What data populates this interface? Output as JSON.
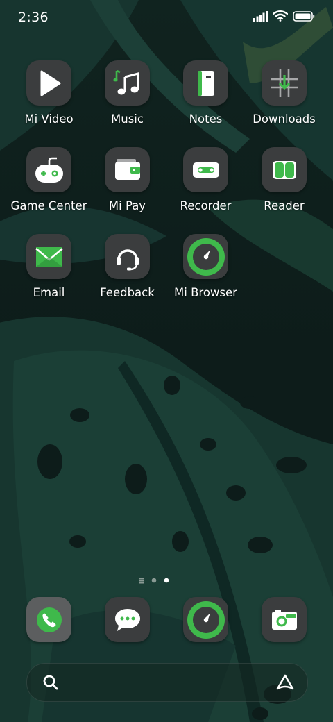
{
  "status_bar": {
    "time": "2:36",
    "icons": [
      "signal-icon",
      "wifi-icon",
      "battery-icon"
    ]
  },
  "apps": [
    {
      "label": "Mi Video",
      "icon": "play-icon"
    },
    {
      "label": "Music",
      "icon": "music-note-icon"
    },
    {
      "label": "Notes",
      "icon": "notebook-icon"
    },
    {
      "label": "Downloads",
      "icon": "download-icon"
    },
    {
      "label": "Game Center",
      "icon": "gamepad-icon"
    },
    {
      "label": "Mi Pay",
      "icon": "wallet-icon"
    },
    {
      "label": "Recorder",
      "icon": "recorder-icon"
    },
    {
      "label": "Reader",
      "icon": "book-icon"
    },
    {
      "label": "Email",
      "icon": "envelope-icon"
    },
    {
      "label": "Feedback",
      "icon": "headset-icon"
    },
    {
      "label": "Mi Browser",
      "icon": "compass-icon"
    }
  ],
  "page_indicator": {
    "pages": 3,
    "current": 3
  },
  "dock": [
    {
      "name": "phone",
      "icon": "phone-icon"
    },
    {
      "name": "messages",
      "icon": "chat-bubble-icon"
    },
    {
      "name": "browser",
      "icon": "compass-icon"
    },
    {
      "name": "camera",
      "icon": "camera-icon"
    }
  ],
  "search": {
    "left_icon": "search-icon",
    "right_icon": "assistant-icon"
  },
  "colors": {
    "accent": "#3fb94b",
    "icon_bg": "#3b3d3e",
    "wallpaper_dark": "#0f2622"
  }
}
